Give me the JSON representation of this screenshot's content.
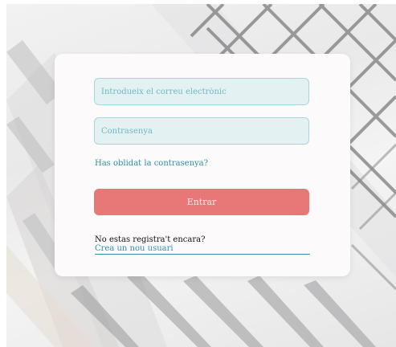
{
  "login_form": {
    "email_placeholder": "Introdueix el correu electrònic",
    "password_placeholder": "Contrasenya",
    "forgot_password_label": "Has oblidat la contrasenya?",
    "submit_label": "Entrar",
    "register_prompt": "No estas registra't encara?",
    "register_link_label": "Crea un nou usuari"
  },
  "colors": {
    "accent": "#2b8fa3",
    "input_background": "#e3f1f3",
    "input_border": "#a7d6dc",
    "submit_background": "#e87878"
  }
}
